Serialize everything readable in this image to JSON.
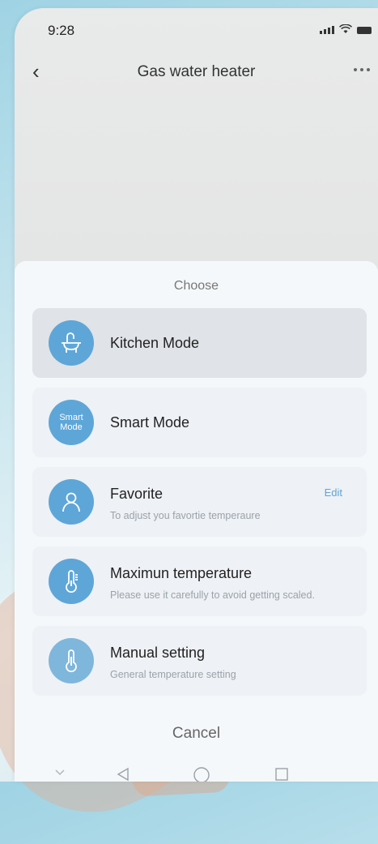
{
  "status_bar": {
    "time": "9:28"
  },
  "header": {
    "title": "Gas water heater"
  },
  "sheet": {
    "title": "Choose",
    "options": [
      {
        "label": "Kitchen Mode",
        "subtitle": "",
        "icon": "faucet-icon"
      },
      {
        "label": "Smart Mode",
        "subtitle": "",
        "icon": "smart-mode-icon",
        "icon_text": "Smart Mode"
      },
      {
        "label": "Favorite",
        "subtitle": "To adjust you favortie temperaure",
        "icon": "person-icon",
        "action": "Edit"
      },
      {
        "label": "Maximun temperature",
        "subtitle": "Please use it carefully to avoid getting scaled.",
        "icon": "thermometer-icon"
      },
      {
        "label": "Manual setting",
        "subtitle": "General temperature setting",
        "icon": "thermometer-icon"
      }
    ],
    "cancel": "Cancel"
  },
  "colors": {
    "accent": "#5ea6d8"
  }
}
